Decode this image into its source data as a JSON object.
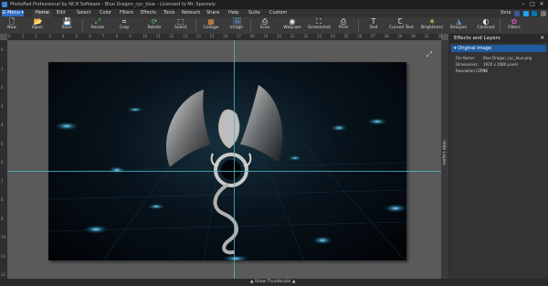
{
  "window": {
    "title": "PhotoPad Professional by NCH Software - Blue Dragon_cyc_blue - Licensed to Mr. Sparsely",
    "minimize": "–",
    "maximize": "□",
    "close": "✕"
  },
  "menubar": {
    "menu_label": "☰ Menu ▾",
    "items": [
      "Home",
      "Edit",
      "Select",
      "Color",
      "Filters",
      "Effects",
      "Tools",
      "Retouch",
      "Share",
      "Help",
      "Suite",
      "Custom"
    ],
    "right_label": "Beta"
  },
  "toolbar": {
    "buttons": [
      {
        "label": "New",
        "icon": "new-icon",
        "glyph": "🗋"
      },
      {
        "label": "Open",
        "icon": "open-icon",
        "glyph": "📂"
      },
      {
        "label": "Save",
        "icon": "save-icon",
        "glyph": "💾"
      },
      {
        "label": "Resize",
        "icon": "resize-icon",
        "glyph": "⤢"
      },
      {
        "label": "Crop",
        "icon": "crop-icon",
        "glyph": "⌗"
      },
      {
        "label": "Rotate",
        "icon": "rotate-icon",
        "glyph": "⟳"
      },
      {
        "label": "Select",
        "icon": "select-icon",
        "glyph": "⬚"
      },
      {
        "label": "Collage",
        "icon": "collage-icon",
        "glyph": "▦"
      },
      {
        "label": "Image",
        "icon": "image-icon",
        "glyph": "🖼"
      },
      {
        "label": "Scan",
        "icon": "scan-icon",
        "glyph": "⎙"
      },
      {
        "label": "Webcam",
        "icon": "webcam-icon",
        "glyph": "◉"
      },
      {
        "label": "Screenshot",
        "icon": "screenshot-icon",
        "glyph": "⛶"
      },
      {
        "label": "Print",
        "icon": "print-icon",
        "glyph": "⎙"
      },
      {
        "label": "Text",
        "icon": "text-icon",
        "glyph": "T"
      },
      {
        "label": "Curved Text",
        "icon": "curved-text-icon",
        "glyph": "Ꞇ"
      },
      {
        "label": "Brightness",
        "icon": "brightness-icon",
        "glyph": "☀"
      },
      {
        "label": "Sharpen",
        "icon": "sharpen-icon",
        "glyph": "◮"
      },
      {
        "label": "Contrast",
        "icon": "contrast-icon",
        "glyph": "◐"
      },
      {
        "label": "Filters",
        "icon": "filters-icon",
        "glyph": "✿"
      }
    ]
  },
  "workspace": {
    "ruler_top": [
      "0",
      "1",
      "2",
      "3",
      "4",
      "5",
      "6",
      "7",
      "8",
      "9",
      "10",
      "11",
      "12",
      "13",
      "14",
      "15",
      "16",
      "17",
      "18",
      "19",
      "20",
      "21",
      "22",
      "23",
      "24",
      "25",
      "26",
      "27",
      "28",
      "29",
      "30",
      "31",
      "32"
    ],
    "ruler_left": [
      "0",
      "1",
      "2",
      "3",
      "4",
      "5",
      "6",
      "7",
      "8",
      "9",
      "10",
      "11",
      "12"
    ],
    "hide_layers": "Hide Layers",
    "fit_glyph": "⤢"
  },
  "panel": {
    "title": "Effects and Layers",
    "close": "✕",
    "section": "▾ Original Image",
    "info": [
      {
        "key": "File Name:",
        "value": "Blue Dragon_cyc_blue.png"
      },
      {
        "key": "Dimensions:",
        "value": "1920 x 1080 pixels"
      },
      {
        "key": "Resolution (DPI):",
        "value": "96"
      }
    ]
  },
  "bottom": {
    "show_thumbnails": "▲ Show Thumbnails ▲"
  },
  "colors": {
    "accent": "#2f6fc6",
    "guide": "#4fb6c8",
    "panel_header": "#1f5b9e"
  }
}
